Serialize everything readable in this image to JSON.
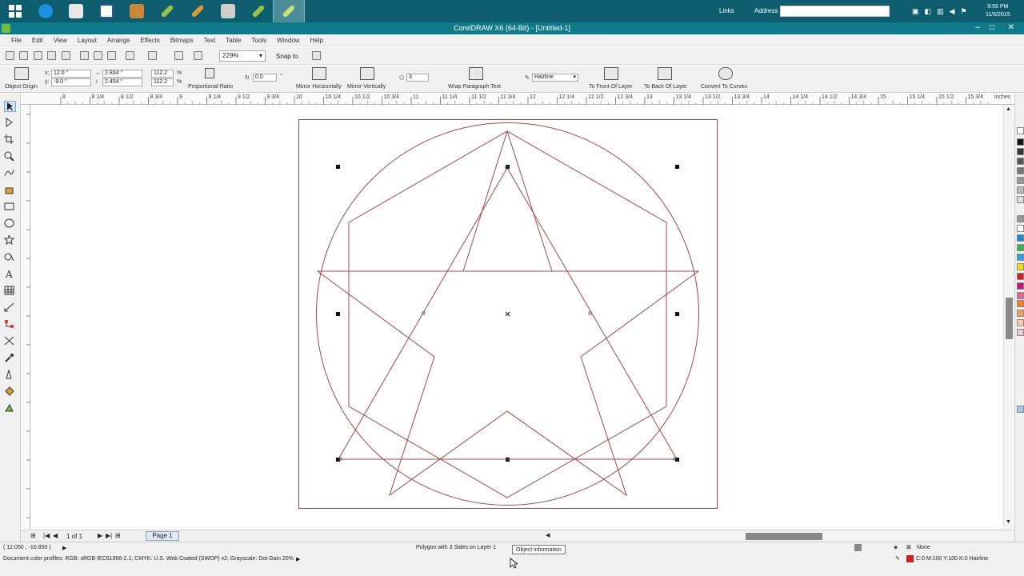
{
  "taskbar": {
    "links_label": "Links",
    "address_label": "Address",
    "address_value": "",
    "clock_time": "9:55 PM",
    "clock_date": "11/5/2015"
  },
  "window": {
    "title": "CorelDRAW X6 (64-Bit) - [Untitled-1]"
  },
  "menu": [
    "File",
    "Edit",
    "View",
    "Layout",
    "Arrange",
    "Effects",
    "Bitmaps",
    "Text",
    "Table",
    "Tools",
    "Window",
    "Help"
  ],
  "toolbar": {
    "zoom_value": "229%",
    "snap_label": "Snap to"
  },
  "property_bar": {
    "object_origin_label": "Object Origin",
    "x_value": "12.0 \"",
    "y_value": "-9.0 \"",
    "width_value": "2.834 \"",
    "height_value": "2.454 \"",
    "scale_w": "112.2",
    "scale_h": "112.2",
    "percent_sign": "%",
    "proportional_label": "Proportional Ratio",
    "rotation_value": "0.0",
    "rotation_unit": "°",
    "mirror_h_label": "Mirror Horizontally",
    "mirror_v_label": "Mirror Vertically",
    "sides_value": "3",
    "wrap_label": "Wrap Paragraph Text",
    "outline_value": "Hairline",
    "to_front_label": "To Front Of Layer",
    "to_back_label": "To Back Of Layer",
    "convert_label": "Convert To Curves"
  },
  "ruler": {
    "top_labels": [
      "8",
      "8 1/4",
      "8 1/2",
      "8 3/4",
      "9",
      "9 1/4",
      "9 1/2",
      "9 3/4",
      "10",
      "10 1/4",
      "10 1/2",
      "10 3/4",
      "11",
      "11 1/4",
      "11 1/2",
      "11 3/4",
      "12",
      "12 1/4",
      "12 1/2",
      "12 3/4",
      "13",
      "13 1/4",
      "13 1/2",
      "13 3/4",
      "14",
      "14 1/4",
      "14 1/2",
      "14 3/4",
      "15",
      "15 1/4",
      "15 1/2",
      "15 3/4"
    ],
    "unit_label": "inches"
  },
  "pagenav": {
    "page_count": "1 of 1",
    "page_tab": "Page 1"
  },
  "status": {
    "coords": "( 12.050 , -10.850 )",
    "object_info": "Polygon with 3 Sides on Layer 1",
    "tooltip": "Object information",
    "color_profiles": "Document color profiles: RGB: sRGB IEC61966-2.1; CMYK: U.S. Web Coated (SWOP) v2; Grayscale: Dot Gain 20%",
    "fill_label": "None",
    "outline_info": "C:0 M:100 Y:100 K:0  Hairline"
  },
  "colors": {
    "taskbar": "#0d5d6e",
    "titlebar": "#0f7a8a",
    "shape_stroke": "#a04848",
    "page_border": "#a04848"
  }
}
